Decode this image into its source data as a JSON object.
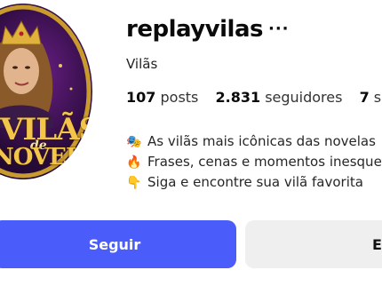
{
  "profile": {
    "username": "replayvilas",
    "more_icon": "ellipsis-icon",
    "display_name": "Vilãs",
    "avatar_text_line1": "VILÃS",
    "avatar_text_de": "de",
    "avatar_text_line2": "NOVELAS"
  },
  "stats": {
    "posts_count": "107",
    "posts_label": "posts",
    "followers_count": "2.831",
    "followers_label": "seguidores",
    "following_count": "7",
    "following_label": "seguindo"
  },
  "bio": [
    {
      "icon": "theater-masks-icon",
      "glyph": "🎭",
      "text": "As vilãs mais icônicas das novelas"
    },
    {
      "icon": "fire-icon",
      "glyph": "🔥",
      "text": "Frases, cenas e momentos inesquecíveis"
    },
    {
      "icon": "pointing-down-icon",
      "glyph": "👇",
      "text": "Siga e encontre sua vilã favorita"
    }
  ],
  "buttons": {
    "follow_label": "Seguir",
    "second_label": "E"
  },
  "colors": {
    "follow_bg": "#4a5dfb",
    "secondary_bg": "#efefef",
    "avatar_gold": "#f3c64b"
  }
}
